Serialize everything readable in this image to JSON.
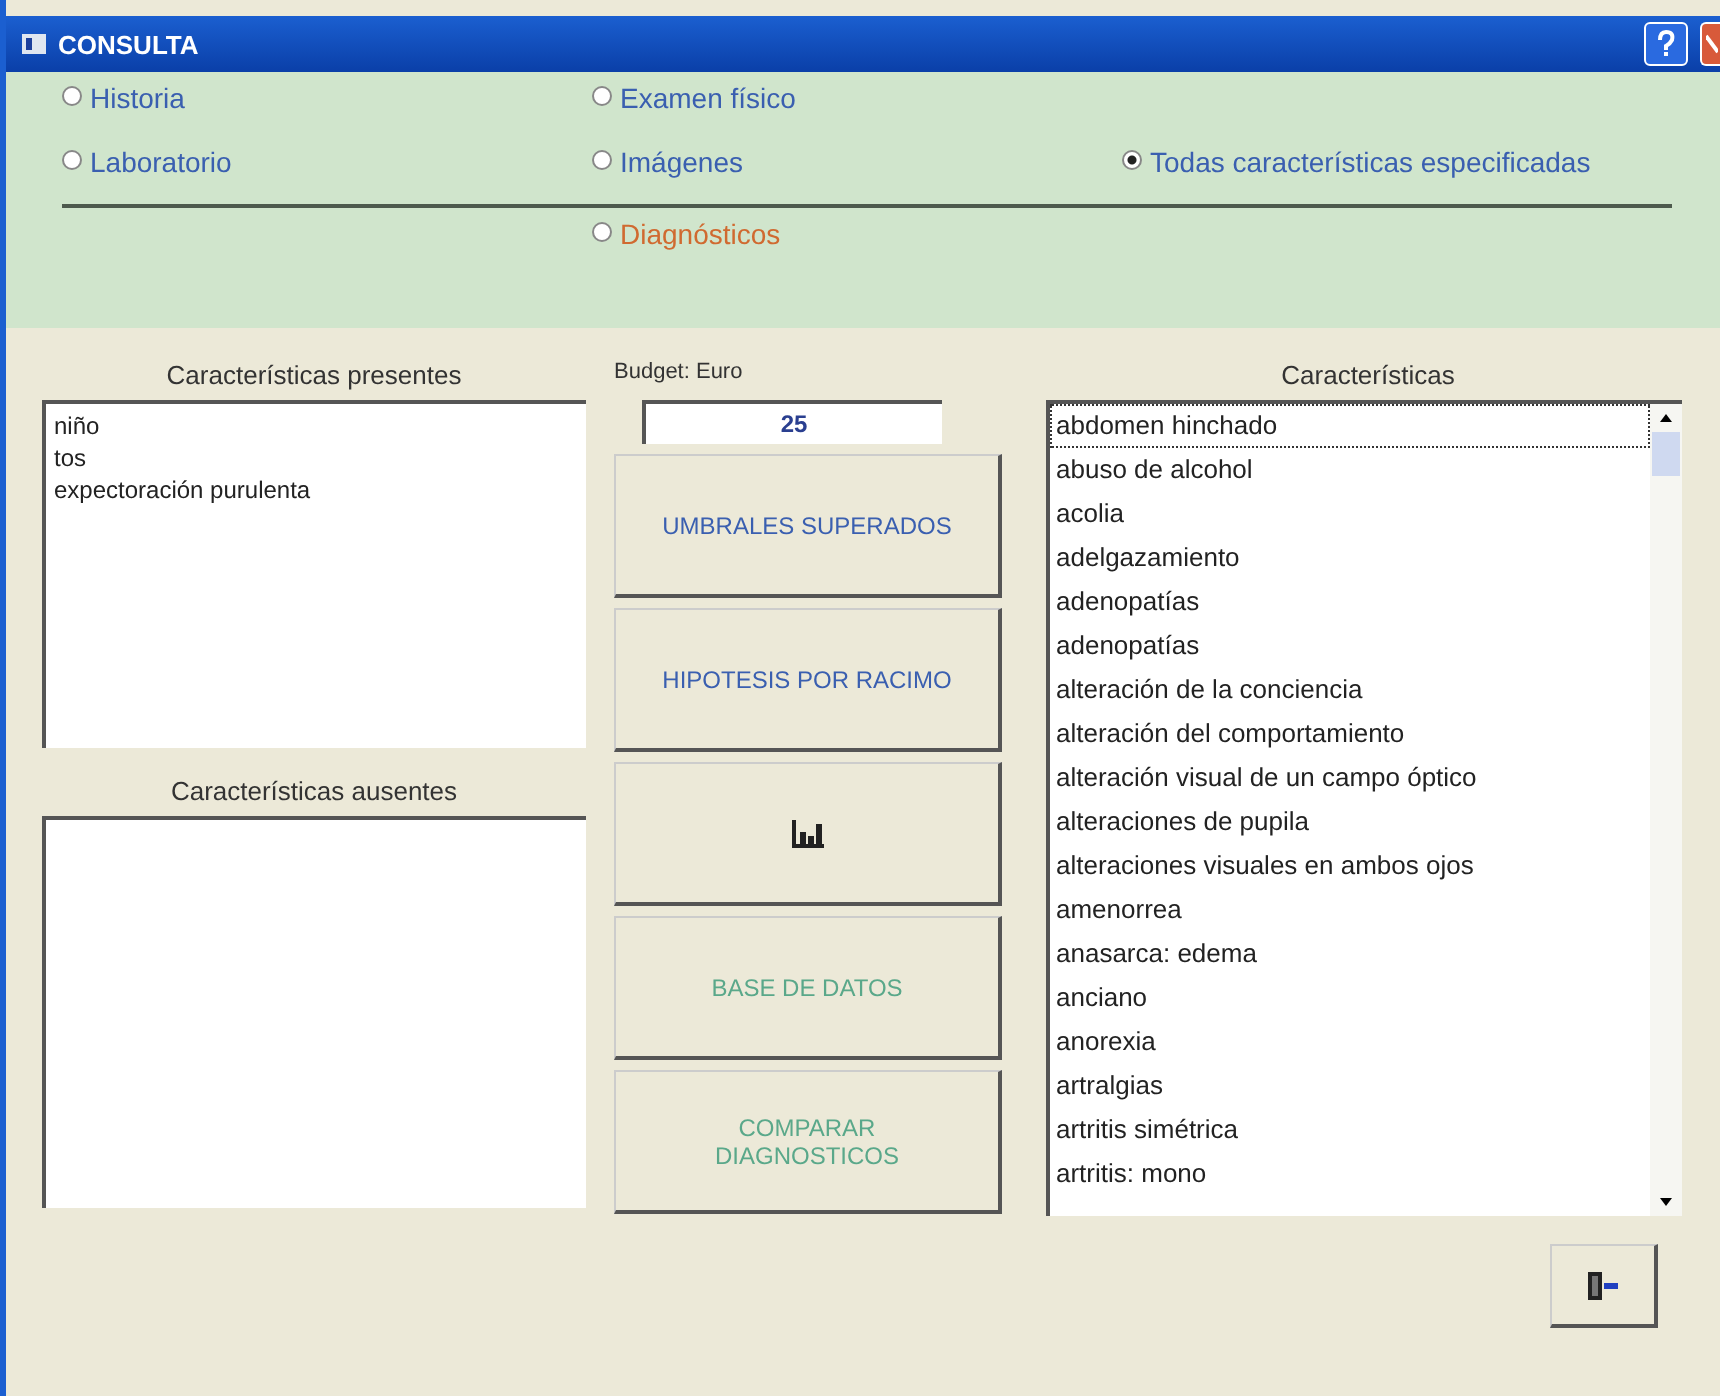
{
  "window": {
    "title": "CONSULTA"
  },
  "categories": [
    {
      "label": "Historia",
      "selected": false,
      "kind": "normal"
    },
    {
      "label": "Examen físico",
      "selected": false,
      "kind": "normal"
    },
    {
      "label": "Laboratorio",
      "selected": false,
      "kind": "normal"
    },
    {
      "label": "Imágenes",
      "selected": false,
      "kind": "normal"
    },
    {
      "label": "Todas características especificadas",
      "selected": true,
      "kind": "normal"
    },
    {
      "label": "Diagnósticos",
      "selected": false,
      "kind": "highlight"
    }
  ],
  "present": {
    "label": "Características presentes",
    "items": [
      "niño",
      "tos",
      "expectoración purulenta"
    ]
  },
  "absent": {
    "label": "Características ausentes"
  },
  "budget": {
    "label": "Budget: Euro",
    "value": "25"
  },
  "actions": [
    {
      "kind": "text",
      "label": "UMBRALES SUPERADOS",
      "disabled": false
    },
    {
      "kind": "text",
      "label": "HIPOTESIS POR RACIMO",
      "disabled": false
    },
    {
      "kind": "chart",
      "disabled": false
    },
    {
      "kind": "text",
      "label": "BASE DE DATOS",
      "disabled": true
    },
    {
      "kind": "text",
      "label": "COMPARAR DIAGNOSTICOS",
      "disabled": true
    }
  ],
  "features": {
    "label": "Características",
    "items": [
      {
        "text": "abdomen hinchado",
        "selected": true
      },
      {
        "text": "abuso de alcohol",
        "selected": false
      },
      {
        "text": "acolia",
        "selected": false
      },
      {
        "text": "adelgazamiento",
        "selected": false
      },
      {
        "text": "adenopatías",
        "selected": false
      },
      {
        "text": "adenopatías",
        "selected": false
      },
      {
        "text": "alteración de la conciencia",
        "selected": false
      },
      {
        "text": "alteración del comportamiento",
        "selected": false
      },
      {
        "text": "alteración visual de un campo óptico",
        "selected": false
      },
      {
        "text": "alteraciones de pupila",
        "selected": false
      },
      {
        "text": "alteraciones visuales en ambos ojos",
        "selected": false
      },
      {
        "text": "amenorrea",
        "selected": false
      },
      {
        "text": "anasarca: edema",
        "selected": false
      },
      {
        "text": "anciano",
        "selected": false
      },
      {
        "text": "anorexia",
        "selected": false
      },
      {
        "text": "artralgias",
        "selected": false
      },
      {
        "text": "artritis simétrica",
        "selected": false
      },
      {
        "text": "artritis: mono",
        "selected": false
      }
    ]
  }
}
